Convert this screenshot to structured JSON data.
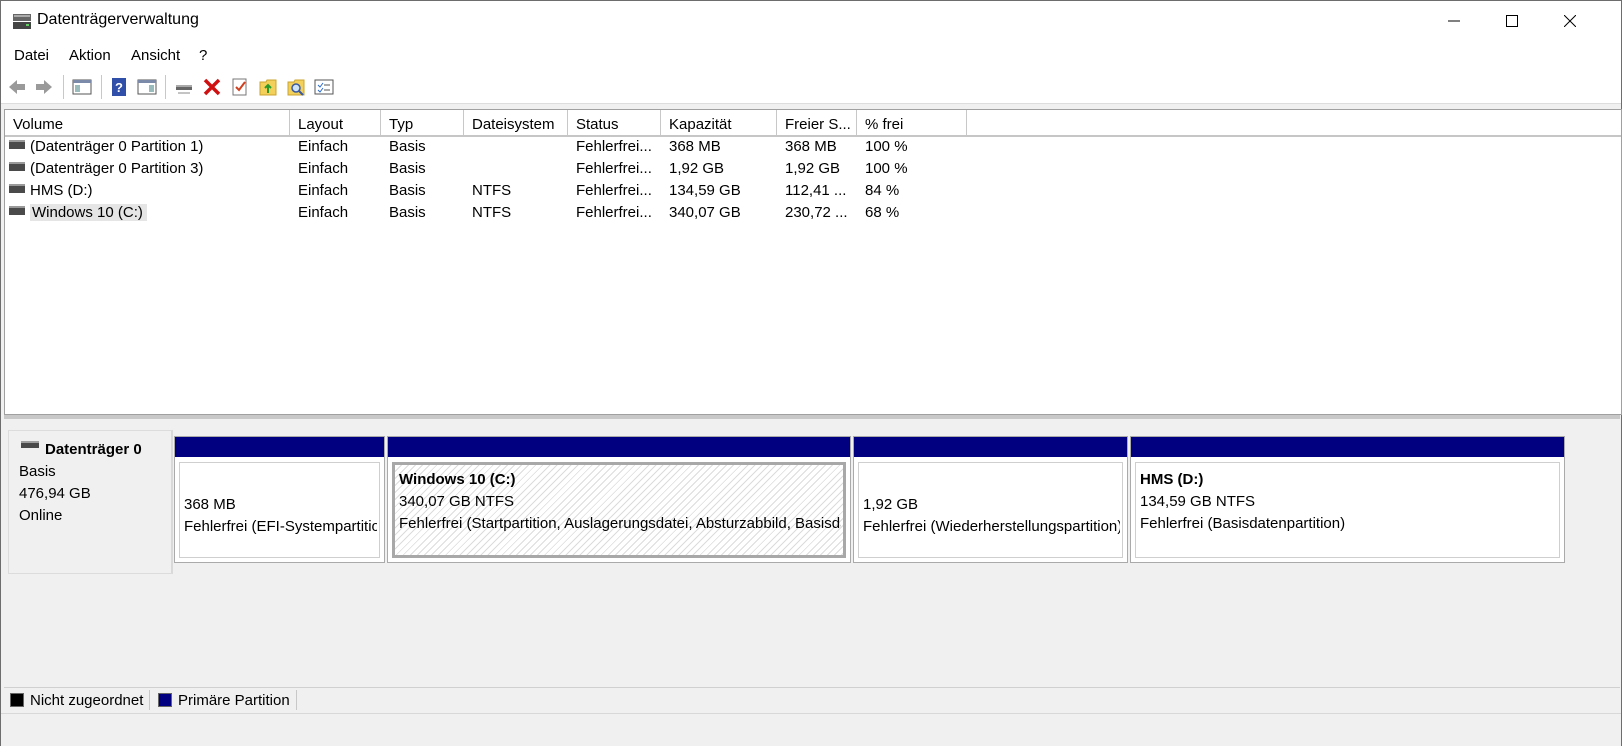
{
  "window": {
    "title": "Datenträgerverwaltung",
    "icon": "disk-management-icon"
  },
  "menu": [
    "Datei",
    "Aktion",
    "Ansicht",
    "?"
  ],
  "toolbar": [
    "back-icon",
    "forward-icon",
    "console-tree-icon",
    "help-icon",
    "action-pane-icon",
    "connect-disk-icon",
    "delete-icon",
    "properties-icon",
    "export-icon",
    "find-icon",
    "settings-icon"
  ],
  "columns": [
    "Volume",
    "Layout",
    "Typ",
    "Dateisystem",
    "Status",
    "Kapazität",
    "Freier S...",
    "% frei"
  ],
  "volumes": [
    {
      "volume": "(Datenträger 0 Partition 1)",
      "layout": "Einfach",
      "typ": "Basis",
      "fs": "",
      "status": "Fehlerfrei...",
      "cap": "368 MB",
      "free": "368 MB",
      "pct": "100 %"
    },
    {
      "volume": "(Datenträger 0 Partition 3)",
      "layout": "Einfach",
      "typ": "Basis",
      "fs": "",
      "status": "Fehlerfrei...",
      "cap": "1,92 GB",
      "free": "1,92 GB",
      "pct": "100 %"
    },
    {
      "volume": "HMS (D:)",
      "layout": "Einfach",
      "typ": "Basis",
      "fs": "NTFS",
      "status": "Fehlerfrei...",
      "cap": "134,59 GB",
      "free": "112,41 ...",
      "pct": "84 %"
    },
    {
      "volume": "Windows 10 (C:)",
      "layout": "Einfach",
      "typ": "Basis",
      "fs": "NTFS",
      "status": "Fehlerfrei...",
      "cap": "340,07 GB",
      "free": "230,72 ...",
      "pct": "68 %"
    }
  ],
  "disk": {
    "name": "Datenträger 0",
    "type": "Basis",
    "size": "476,94 GB",
    "state": "Online"
  },
  "partitions": [
    {
      "title": "",
      "size": "368 MB",
      "status": "Fehlerfrei (EFI-Systempartition)"
    },
    {
      "title": "Windows 10  (C:)",
      "size": "340,07 GB NTFS",
      "status": "Fehlerfrei (Startpartition, Auslagerungsdatei, Absturzabbild, Basisdatenpartition)"
    },
    {
      "title": "",
      "size": "1,92 GB",
      "status": "Fehlerfrei (Wiederherstellungspartition)"
    },
    {
      "title": "HMS  (D:)",
      "size": "134,59 GB NTFS",
      "status": "Fehlerfrei (Basisdatenpartition)"
    }
  ],
  "legend": [
    {
      "label": "Nicht zugeordnet",
      "color": "#000000"
    },
    {
      "label": "Primäre Partition",
      "color": "#000080"
    }
  ]
}
